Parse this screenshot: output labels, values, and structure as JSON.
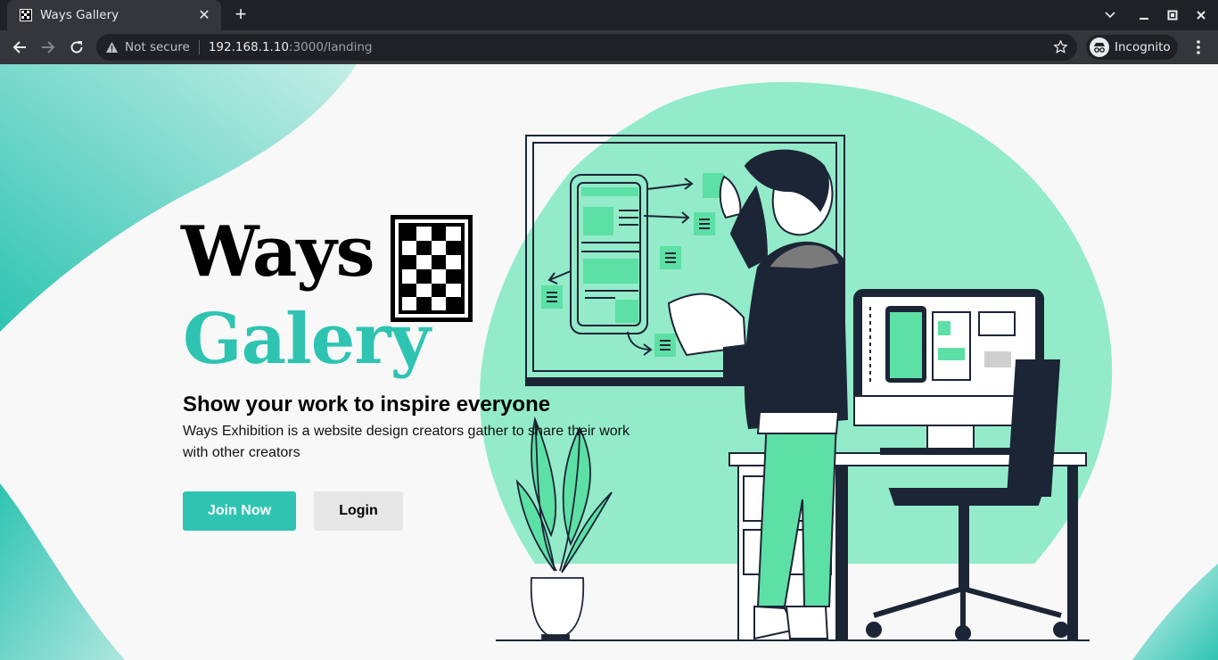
{
  "browser": {
    "tab_title": "Ways Gallery",
    "security_label": "Not secure",
    "url_host": "192.168.1.10",
    "url_path": ":3000/landing",
    "profile_label": "Incognito"
  },
  "hero": {
    "logo_line1": "Ways",
    "logo_line2": "Galery",
    "headline": "Show your work to inspire everyone",
    "description": "Ways Exhibition is a website design creators gather to share their work with other creators",
    "join_button": "Join Now",
    "login_button": "Login"
  },
  "colors": {
    "accent": "#2fc4b2",
    "blob": "#93ebc9",
    "ink": "#1c2536",
    "plant_green": "#5de0a5"
  },
  "icons": [
    "favicon-checker-icon",
    "close-icon",
    "plus-icon",
    "chevron-down-icon",
    "minimize-icon",
    "maximize-icon",
    "window-close-icon",
    "back-arrow-icon",
    "forward-arrow-icon",
    "reload-icon",
    "warning-icon",
    "star-icon",
    "incognito-icon",
    "kebab-menu-icon"
  ]
}
